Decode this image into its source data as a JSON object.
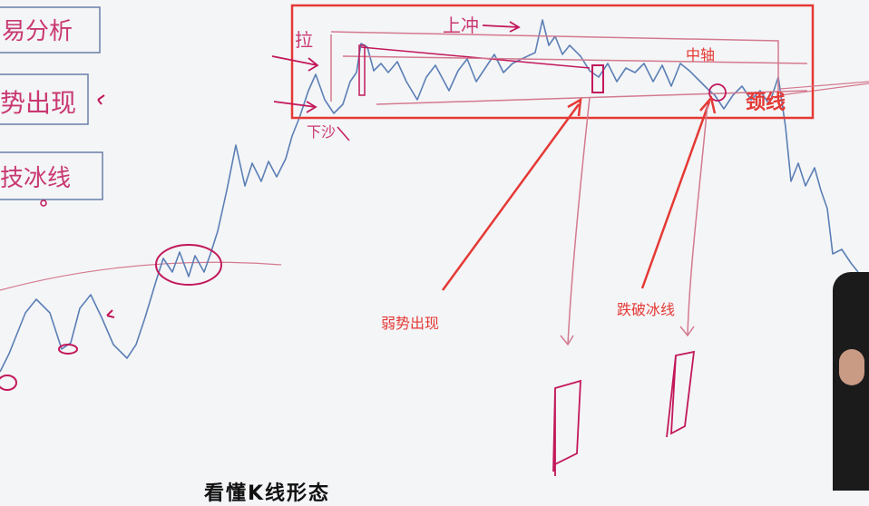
{
  "labels": {
    "weak_appears": "弱势出现",
    "break_ice_line": "跌破冰线",
    "middle_axis": "中轴",
    "neckline": "颈线"
  },
  "handwriting": {
    "left_box_1": "易分析",
    "left_box_2": "势出现",
    "left_box_3": "技冰线",
    "upthrust": "上冲",
    "top_mark": "拉",
    "low_mark": "下沙"
  },
  "bottom_caption": "看懂K线形态"
}
